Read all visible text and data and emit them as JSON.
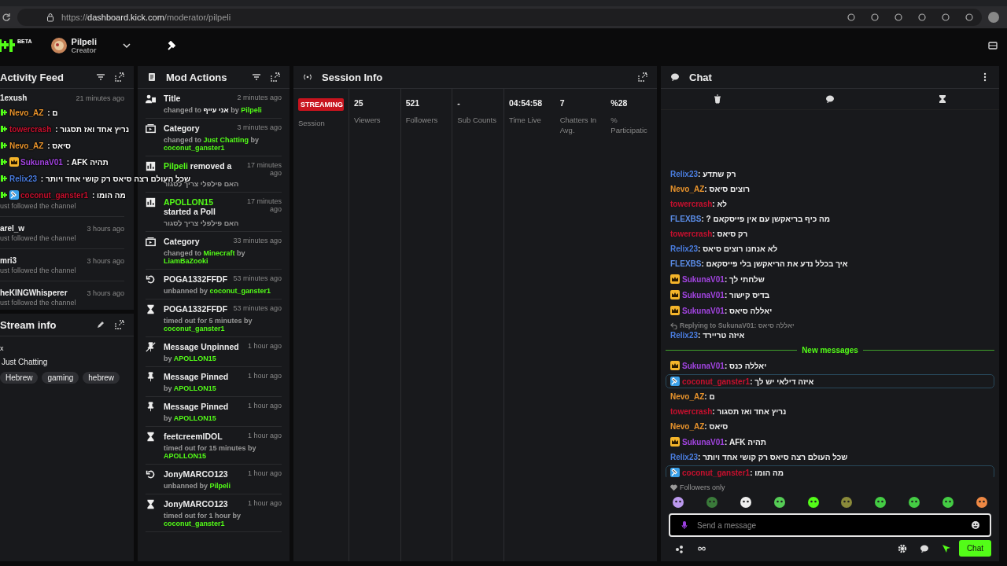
{
  "browser": {
    "url_scheme": "https://",
    "url_host": "dashboard.kick.com",
    "url_path": "/moderator/pilpeli"
  },
  "header": {
    "logo_badge": "BETA",
    "user": {
      "name": "Pilpeli",
      "role": "Creator"
    }
  },
  "activity_feed": {
    "title": "Activity Feed",
    "items": [
      {
        "name": "1exush",
        "time": "21 minutes ago"
      }
    ],
    "floating": [
      {
        "user": "Nevo_AZ",
        "color": "#e8932c",
        "sep": " : ",
        "text": "ם"
      },
      {
        "user": "towercrash",
        "color": "#c8102e",
        "sep": " : ",
        "text": "נריץ אחד ואז תסגור"
      },
      {
        "user": "Nevo_AZ",
        "color": "#e8932c",
        "sep": " : ",
        "text": "סיאס"
      },
      {
        "user": "SukunaV01",
        "color": "#a244e0",
        "badge": {
          "kind": "crown"
        },
        "sep": " : ",
        "text": "תהיה AFK"
      },
      {
        "user": "Relix23",
        "color": "#4a7de0",
        "sep": " : ",
        "text": "שכל העולם רצה סיאס רק קושי אחד ויותר"
      },
      {
        "user": "coconut_ganster1",
        "color": "#c8102e",
        "badge": {
          "kind": "mod"
        },
        "sep": " : ",
        "text": "מה הומו"
      }
    ],
    "after_note": "ust followed the channel",
    "more": [
      {
        "name": "arel_w",
        "time": "3 hours ago",
        "sub": "ust followed the channel"
      },
      {
        "name": "mri3",
        "time": "3 hours ago",
        "sub": "ust followed the channel"
      },
      {
        "name": "heKINGWhisperer",
        "time": "3 hours ago",
        "sub": "ust followed the channel"
      }
    ]
  },
  "stream_info": {
    "title": "Stream info",
    "title_line": "x",
    "category": "Just Chatting",
    "tags": [
      "Hebrew",
      "gaming",
      "hebrew"
    ]
  },
  "mod_actions": {
    "title": "Mod Actions",
    "items": [
      {
        "kind": "title",
        "head": [
          {
            "t": "Title"
          }
        ],
        "time": "2 minutes ago",
        "sub": [
          {
            "t": "changed to "
          },
          {
            "t": "אני עייף",
            "kind": "value"
          },
          {
            "t": " by "
          },
          {
            "t": "Pilpeli",
            "kind": "user"
          }
        ]
      },
      {
        "kind": "category",
        "head": [
          {
            "t": "Category"
          }
        ],
        "time": "3 minutes ago",
        "sub": [
          {
            "t": "changed to "
          },
          {
            "t": "Just Chatting",
            "kind": "user"
          },
          {
            "t": " by "
          },
          {
            "t": "coconut_ganster1",
            "kind": "user"
          }
        ]
      },
      {
        "kind": "poll",
        "head": [
          {
            "t": "Pilpeli",
            "kind": "user"
          },
          {
            "t": " removed a"
          }
        ],
        "time": "17 minutes ago",
        "sub": [
          {
            "t": "האם פילפלי צריך לסגור"
          }
        ]
      },
      {
        "kind": "poll",
        "head": [
          {
            "t": "APOLLON15",
            "kind": "user"
          },
          {
            "t": " started a Poll"
          }
        ],
        "time": "17 minutes ago",
        "sub": [
          {
            "t": "האם פילפלי צריך לסגור"
          }
        ]
      },
      {
        "kind": "category",
        "head": [
          {
            "t": "Category"
          }
        ],
        "time": "33 minutes ago",
        "sub": [
          {
            "t": "changed to "
          },
          {
            "t": "Minecraft",
            "kind": "user"
          },
          {
            "t": " by "
          },
          {
            "t": "LiamBaZooki",
            "kind": "user"
          }
        ]
      },
      {
        "kind": "unban",
        "head": [
          {
            "t": "POGA1332FFDF"
          }
        ],
        "time": "53 minutes ago",
        "sub": [
          {
            "t": "unbanned by "
          },
          {
            "t": "coconut_ganster1",
            "kind": "user"
          }
        ]
      },
      {
        "kind": "timeout",
        "head": [
          {
            "t": "POGA1332FFDF"
          }
        ],
        "time": "53 minutes ago",
        "sub": [
          {
            "t": "timed out for 5 minutes by "
          },
          {
            "t": "coconut_ganster1",
            "kind": "user"
          }
        ]
      },
      {
        "kind": "unpin",
        "head": [
          {
            "t": "Message Unpinned"
          }
        ],
        "time": "1 hour ago",
        "sub": [
          {
            "t": "by "
          },
          {
            "t": "APOLLON15",
            "kind": "user"
          }
        ]
      },
      {
        "kind": "pin",
        "head": [
          {
            "t": "Message Pinned"
          }
        ],
        "time": "1 hour ago",
        "sub": [
          {
            "t": "by "
          },
          {
            "t": "APOLLON15",
            "kind": "user"
          }
        ]
      },
      {
        "kind": "pin",
        "head": [
          {
            "t": "Message Pinned"
          }
        ],
        "time": "1 hour ago",
        "sub": [
          {
            "t": "by "
          },
          {
            "t": "APOLLON15",
            "kind": "user"
          }
        ]
      },
      {
        "kind": "timeout",
        "head": [
          {
            "t": "feetcreemIDOL"
          }
        ],
        "time": "1 hour ago",
        "sub": [
          {
            "t": "timed out for 15 minutes by "
          },
          {
            "t": "APOLLON15",
            "kind": "user"
          }
        ]
      },
      {
        "kind": "unban",
        "head": [
          {
            "t": "JonyMARCO123"
          }
        ],
        "time": "1 hour ago",
        "sub": [
          {
            "t": "unbanned by "
          },
          {
            "t": "Pilpeli",
            "kind": "user"
          }
        ]
      },
      {
        "kind": "timeout",
        "head": [
          {
            "t": "JonyMARCO123"
          }
        ],
        "time": "1 hour ago",
        "sub": [
          {
            "t": "timed out for 1 hour by "
          },
          {
            "t": "coconut_ganster1",
            "kind": "user"
          }
        ]
      }
    ]
  },
  "session_info": {
    "title": "Session Info",
    "status": "STREAMING",
    "status_label": "Session",
    "stats": [
      {
        "value": "25",
        "label": "Viewers"
      },
      {
        "value": "521",
        "label": "Followers"
      },
      {
        "value": "-",
        "label": "Sub Counts"
      },
      {
        "value": "04:54:58",
        "label": "Time Live"
      },
      {
        "value": "7",
        "label": "Chatters In Avg."
      },
      {
        "value": "%28",
        "label": "% Participatic"
      }
    ]
  },
  "chat": {
    "title": "Chat",
    "messages": [
      {
        "kind": "message",
        "user": "Relix23",
        "color": "#4a7de0",
        "highlighted": false,
        "sep": ": ",
        "text": "רק שתדע"
      },
      {
        "kind": "message",
        "user": "Nevo_AZ",
        "color": "#e8932c",
        "highlighted": false,
        "sep": ": ",
        "text": "רוצים סיאס"
      },
      {
        "kind": "message",
        "user": "towercrash",
        "color": "#c8102e",
        "highlighted": false,
        "sep": ": ",
        "text": "לא"
      },
      {
        "kind": "message",
        "user": "FLEXBS",
        "color": "#5b8de8",
        "highlighted": false,
        "sep": ": ",
        "text": "מה כיף בריאקשן עם אין פייסקאם ?"
      },
      {
        "kind": "message",
        "user": "towercrash",
        "color": "#c8102e",
        "highlighted": false,
        "sep": ": ",
        "text": "רק סיאס"
      },
      {
        "kind": "message",
        "user": "Relix23",
        "color": "#4a7de0",
        "highlighted": false,
        "sep": ": ",
        "text": "לא אנחנו רוצים סיאס"
      },
      {
        "kind": "message",
        "user": "FLEXBS",
        "color": "#5b8de8",
        "highlighted": false,
        "sep": ": ",
        "text": "איך בכלל נדע את הריאקשן בלי פייסקאם"
      },
      {
        "kind": "message",
        "user": "SukunaV01",
        "color": "#a244e0",
        "badge": {
          "kind": "crown"
        },
        "highlighted": false,
        "sep": ": ",
        "text": "שלחתי לך"
      },
      {
        "kind": "message",
        "user": "SukunaV01",
        "color": "#a244e0",
        "badge": {
          "kind": "crown"
        },
        "highlighted": false,
        "sep": ": ",
        "text": "בדיס קישור"
      },
      {
        "kind": "message",
        "user": "SukunaV01",
        "color": "#a244e0",
        "badge": {
          "kind": "crown"
        },
        "highlighted": false,
        "sep": ": ",
        "text": "יאללה סיאס"
      },
      {
        "kind": "reply",
        "reply_to": "Replying to SukunaV01: יאללה סיאס",
        "user": "Relix23",
        "color": "#4a7de0",
        "highlighted": false,
        "sep": ": ",
        "text": "איזה טריירד"
      },
      {
        "kind": "divider",
        "text": "New messages"
      },
      {
        "kind": "message",
        "user": "SukunaV01",
        "color": "#a244e0",
        "badge": {
          "kind": "crown"
        },
        "highlighted": false,
        "sep": ": ",
        "text": "יאללה כנס"
      },
      {
        "kind": "message",
        "user": "coconut_ganster1",
        "color": "#c8102e",
        "badge": {
          "kind": "mod"
        },
        "highlighted": true,
        "sep": ": ",
        "text": "איזה דילאי יש לך"
      },
      {
        "kind": "message",
        "user": "Nevo_AZ",
        "color": "#e8932c",
        "highlighted": false,
        "sep": ": ",
        "text": "ם"
      },
      {
        "kind": "message",
        "user": "towercrash",
        "color": "#c8102e",
        "highlighted": false,
        "sep": ": ",
        "text": "נריץ אחד ואז תסגור"
      },
      {
        "kind": "message",
        "user": "Nevo_AZ",
        "color": "#e8932c",
        "highlighted": false,
        "sep": ": ",
        "text": "סיאס"
      },
      {
        "kind": "message",
        "user": "SukunaV01",
        "color": "#a244e0",
        "badge": {
          "kind": "crown"
        },
        "highlighted": false,
        "sep": ": ",
        "text": "תהיה AFK"
      },
      {
        "kind": "message",
        "user": "Relix23",
        "color": "#4a7de0",
        "highlighted": false,
        "sep": ": ",
        "text": "שכל העולם רצה סיאס רק קושי אחד ויותר"
      },
      {
        "kind": "message",
        "user": "coconut_ganster1",
        "color": "#c8102e",
        "badge": {
          "kind": "mod"
        },
        "highlighted": true,
        "sep": ": ",
        "text": "מה הומו"
      }
    ],
    "mode": "Followers only",
    "input": {
      "placeholder": "Send a message"
    },
    "send_button": "Chat"
  }
}
